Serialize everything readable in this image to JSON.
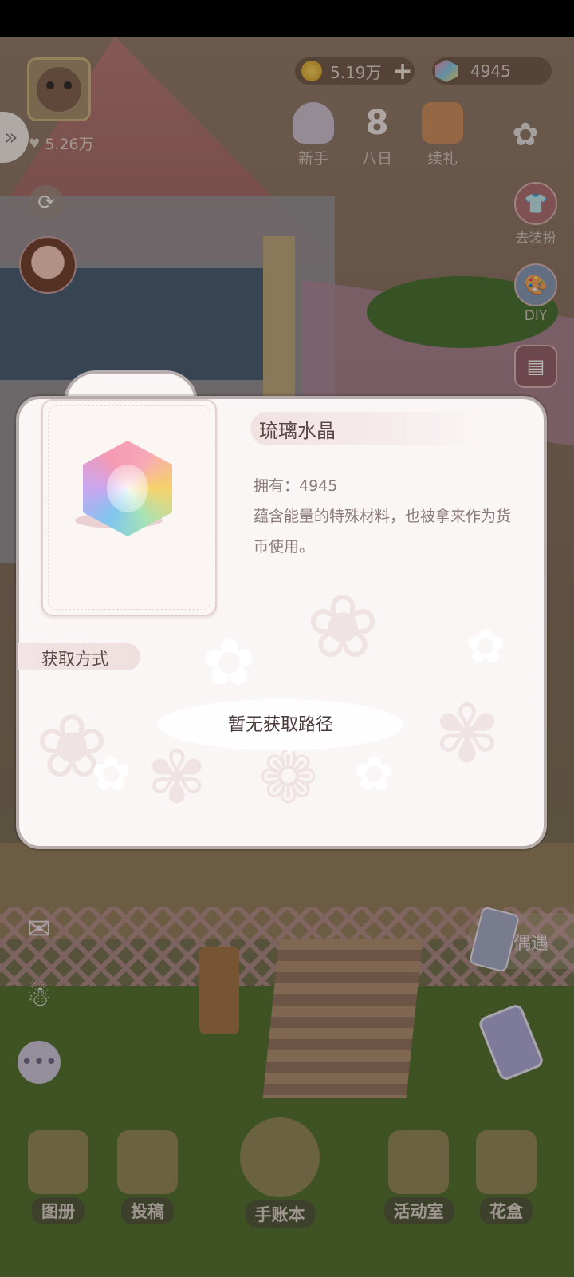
{
  "hud": {
    "gold_amount": "5.19万",
    "gem_amount": "4945",
    "level_value": "5.26万",
    "top_icons": [
      {
        "label": "新手"
      },
      {
        "label": "八日"
      },
      {
        "label": "续礼"
      }
    ],
    "right_icons": [
      {
        "label": "去装扮"
      },
      {
        "label": "DIY"
      }
    ],
    "ouyu_label": "偶遇",
    "bottom_nav": [
      {
        "label": "图册"
      },
      {
        "label": "投稿"
      },
      {
        "label": "手账本"
      },
      {
        "label": "活动室"
      },
      {
        "label": "花盒"
      }
    ]
  },
  "item_dialog": {
    "name": "琉璃水晶",
    "owned": "拥有：4945",
    "description": "蕴含能量的特殊材料，也被拿来作为货币使用。",
    "acquire_label": "获取方式",
    "no_path_text": "暂无获取路径"
  },
  "colors": {
    "dialog_bg": "#fbf6f6",
    "dialog_border": "#b7adad",
    "text_primary": "#5a4646",
    "text_secondary": "#8a7a7a"
  }
}
